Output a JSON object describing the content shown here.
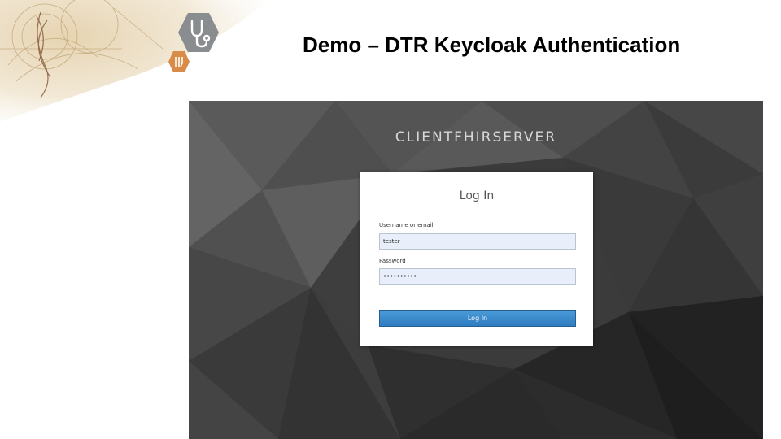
{
  "slide": {
    "title": "Demo – DTR Keycloak Authentication"
  },
  "icons": {
    "primary": "stethoscope-icon",
    "secondary": "pen-icon"
  },
  "keycloak": {
    "realm_name": "CLIENTFHIRSERVER",
    "login_title": "Log In",
    "username_label": "Username or email",
    "username_value": "tester",
    "password_label": "Password",
    "password_value": "••••••••••",
    "login_button": "Log In"
  },
  "colors": {
    "accent_blue": "#337ab7",
    "background_dark": "#3a3a3a",
    "hex_gray": "#8a8d90",
    "hex_orange": "#d98c48"
  }
}
